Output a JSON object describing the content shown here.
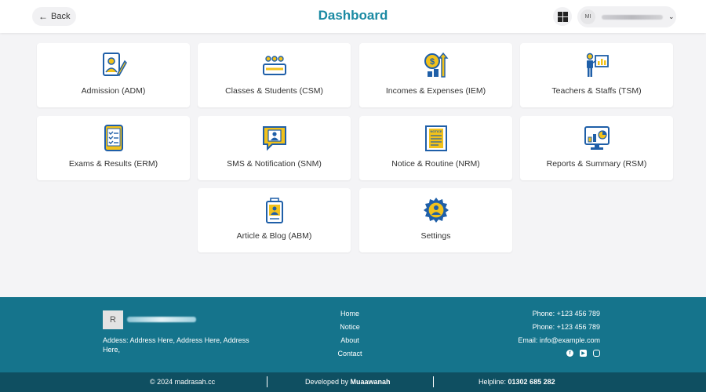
{
  "header": {
    "back_label": "Back",
    "title": "Dashboard",
    "user_initials": "MI"
  },
  "modules": [
    {
      "label": "Admission (ADM)",
      "icon": "admission-icon"
    },
    {
      "label": "Classes & Students (CSM)",
      "icon": "classroom-icon"
    },
    {
      "label": "Incomes & Expenses (IEM)",
      "icon": "money-growth-icon"
    },
    {
      "label": "Teachers & Staffs (TSM)",
      "icon": "teacher-board-icon"
    },
    {
      "label": "Exams & Results (ERM)",
      "icon": "checklist-tablet-icon"
    },
    {
      "label": "SMS & Notification (SNM)",
      "icon": "message-user-icon"
    },
    {
      "label": "Notice & Routine (NRM)",
      "icon": "notice-paper-icon"
    },
    {
      "label": "Reports & Summary (RSM)",
      "icon": "report-monitor-icon"
    },
    {
      "label": "Article & Blog (ABM)",
      "icon": "id-badge-icon"
    },
    {
      "label": "Settings",
      "icon": "gear-user-icon"
    }
  ],
  "footer": {
    "logo_letter": "R",
    "address": "Addess: Address Here, Address Here, Address Here,",
    "links": [
      "Home",
      "Notice",
      "About",
      "Contact"
    ],
    "phone_1": "Phone: +123 456 789",
    "phone_2": "Phone: +123 456 789",
    "email_label": "Email: ",
    "email": "info@example.com",
    "socials": [
      "facebook-icon",
      "youtube-icon",
      "instagram-icon"
    ],
    "copyright": "© 2024 madrasah.cc",
    "developed_label": "Developed by ",
    "developer": "Muaawanah",
    "helpline_label": "Helpline: ",
    "helpline": "01302 685 282"
  },
  "colors": {
    "accent": "#1b8aa3",
    "icon_blue": "#1f5fa8",
    "icon_yellow": "#f2c21b",
    "footer_bg": "#15748c",
    "footer_bottom": "#0f4f61"
  }
}
